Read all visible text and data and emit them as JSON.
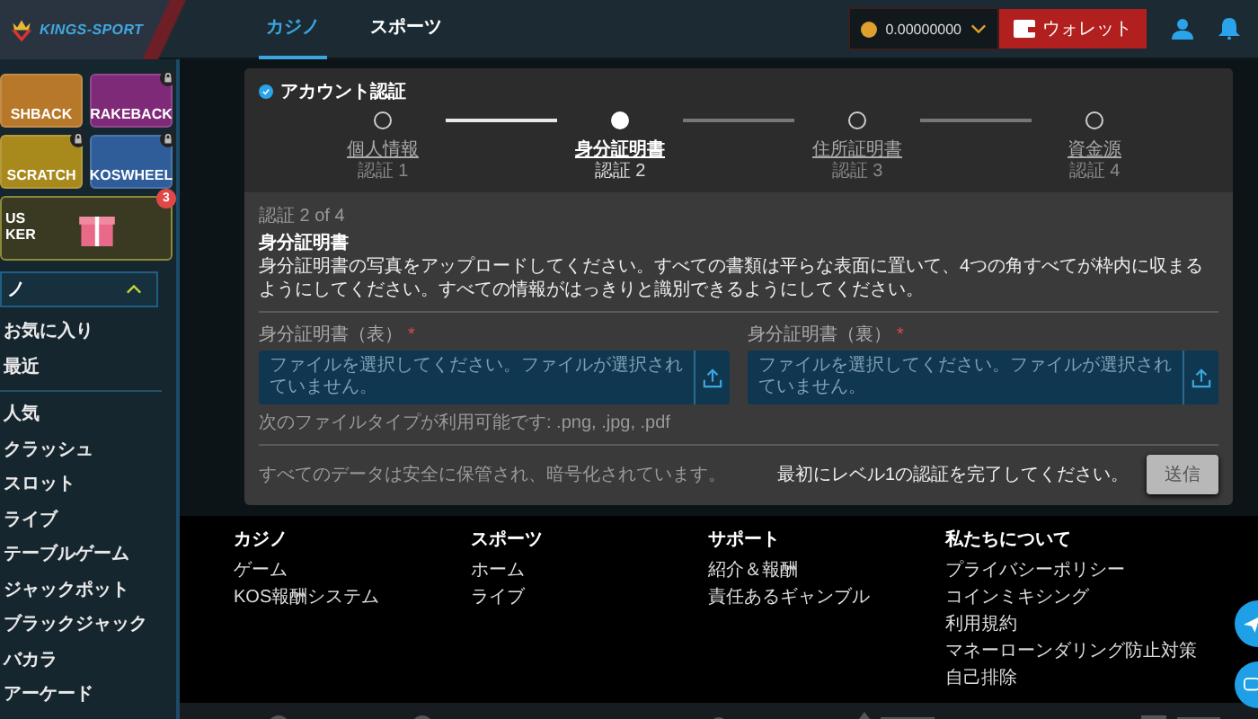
{
  "header": {
    "logo": "KINGS-SPORT",
    "tabs": [
      {
        "label": "カジノ",
        "selected": true
      },
      {
        "label": "スポーツ",
        "selected": false
      }
    ],
    "balance": "0.00000000",
    "wallet_button": "ウォレット"
  },
  "sidebar": {
    "promos": [
      {
        "lines": [
          "SHBACK"
        ],
        "color": "#b8782a",
        "locked": false
      },
      {
        "lines": [
          "RAKEBACK"
        ],
        "color": "#7e2a78",
        "locked": true
      },
      {
        "lines": [
          "SCRATCH"
        ],
        "color": "#a88a1c",
        "locked": true
      },
      {
        "lines": [
          "KOSWHEEL"
        ],
        "color": "#2f5d9a",
        "locked": true
      },
      {
        "lines": [
          "US",
          "KER"
        ],
        "color": "#3a3a22",
        "locked": false,
        "badge": "3"
      }
    ],
    "section": {
      "label": "ノ",
      "expanded": true
    },
    "groups": [
      [
        "お気に入り",
        "最近"
      ],
      [
        "人気",
        "クラッシュ",
        "スロット",
        "ライブ",
        "テーブルゲーム",
        "ジャックポット",
        "ブラックジャック",
        "バカラ",
        "アーケード"
      ]
    ]
  },
  "card": {
    "title": "アカウント認証",
    "steps": [
      {
        "label": "個人情報",
        "sub": "認証 1",
        "selected": false
      },
      {
        "label": "身分証明書",
        "sub": "認証 2",
        "selected": true
      },
      {
        "label": "住所証明書",
        "sub": "認証 3",
        "selected": false
      },
      {
        "label": "資金源",
        "sub": "認証 4",
        "selected": false
      }
    ],
    "step_count": "認証 2 of 4",
    "heading": "身分証明書",
    "description": "身分証明書の写真をアップロードしてください。すべての書類は平らな表面に置いて、4つの角すべてが枠内に収まるようにしてください。すべての情報がはっきりと識別できるようにしてください。",
    "fields": [
      {
        "label": "身分証明書（表）",
        "required_mark": "*",
        "placeholder": "ファイルを選択してください。ファイルが選択されていません。"
      },
      {
        "label": "身分証明書（裏）",
        "required_mark": "*",
        "placeholder": "ファイルを選択してください。ファイルが選択されていません。"
      }
    ],
    "file_types": "次のファイルタイプが利用可能です: .png, .jpg, .pdf",
    "security_note": "すべてのデータは安全に保管され、暗号化されています。",
    "warning": "最初にレベル1の認証を完了してください。",
    "submit": {
      "label": "送信",
      "disabled": true
    }
  },
  "footer": {
    "columns": [
      {
        "title": "カジノ",
        "links": [
          "ゲーム",
          "KOS報酬システム"
        ]
      },
      {
        "title": "スポーツ",
        "links": [
          "ホーム",
          "ライブ"
        ]
      },
      {
        "title": "サポート",
        "links": [
          "紹介＆報酬",
          "責任あるギャンブル"
        ]
      },
      {
        "title": "私たちについて",
        "links": [
          "プライバシーポリシー",
          "コインミキシング",
          "利用規約",
          "マネーローンダリング防止対策",
          "自己排除"
        ]
      }
    ]
  }
}
